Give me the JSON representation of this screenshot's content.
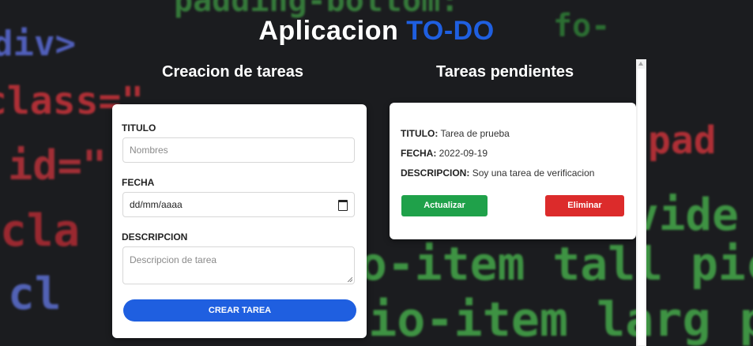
{
  "app": {
    "title_main": "Aplicacion",
    "title_accent": "TO-DO"
  },
  "background_code": [
    "padding-bottom:",
    "div>",
    "class=\"",
    "id=\"",
    "cla",
    "io-item tall pictu",
    "lio-item larg pic",
    "vide",
    "pad",
    "cl",
    "fo-"
  ],
  "form": {
    "heading": "Creacion de tareas",
    "title_label": "TITULO",
    "title_placeholder": "Nombres",
    "date_label": "FECHA",
    "date_value": "dd/mm/aaaa",
    "desc_label": "DESCRIPCION",
    "desc_placeholder": "Descripcion de tarea",
    "submit_label": "CREAR TAREA"
  },
  "tasks": {
    "heading": "Tareas pendientes",
    "items": [
      {
        "title_key": "TITULO:",
        "title": "Tarea de prueba",
        "date_key": "FECHA:",
        "date": "2022-09-19",
        "desc_key": "DESCRIPCION:",
        "desc": "Soy una tarea de verificacion",
        "update_label": "Actualizar",
        "delete_label": "Eliminar"
      }
    ]
  },
  "colors": {
    "accent": "#1f5fe0",
    "update": "#1fa14a",
    "delete": "#dc2b2b"
  },
  "icons": [
    "calendar-icon",
    "resize-handle-icon",
    "scroll-up-icon"
  ]
}
